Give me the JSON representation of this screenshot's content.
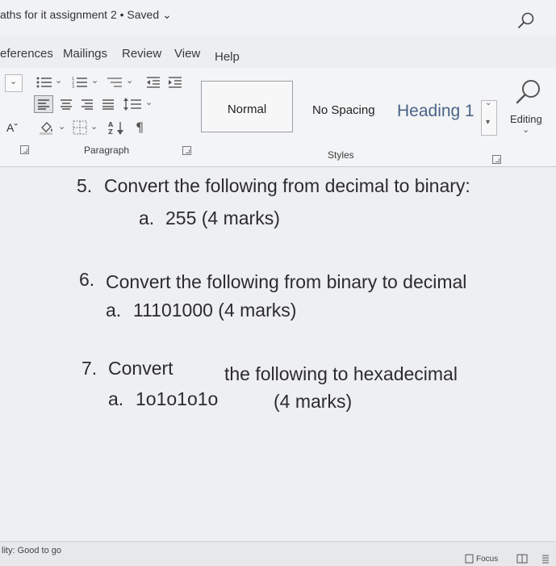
{
  "titlebar": {
    "doc_title": "aths for it assignment 2 • Saved ⌄"
  },
  "ribbon_tabs": [
    "eferences",
    "Mailings",
    "Review",
    "View",
    "Help"
  ],
  "ribbon": {
    "font_grow_label": "Aˇ",
    "paragraph_label": "Paragraph",
    "styles_label": "Styles",
    "styles": [
      "Normal",
      "No Spacing",
      "Heading 1"
    ],
    "editing_label": "Editing"
  },
  "document": {
    "q5_number": "5.",
    "q5_text": "Convert the following from decimal to binary:",
    "q5a_marker": "a.",
    "q5a_text": "255   (4 marks)",
    "q6_number": "6.",
    "q6_text": "Convert the following from binary to decimal",
    "q6a_marker": "a.",
    "q6a_text": "11101000 (4 marks)",
    "q7_number": "7.",
    "q7_word": "Convert",
    "q7_text": "the following to hexadecimal",
    "q7a_marker": "a.",
    "q7a_value": "1o1o1o1o",
    "q7a_marks": "(4 marks)"
  },
  "statusbar": {
    "accessibility": "lity: Good to go",
    "focus": "Focus"
  },
  "icons": [
    "search-icon",
    "bullets-icon",
    "numbering-icon",
    "multilevel-list-icon",
    "decrease-indent-icon",
    "increase-indent-icon",
    "align-left-icon",
    "align-center-icon",
    "align-right-icon",
    "justify-icon",
    "line-spacing-icon",
    "shading-icon",
    "borders-icon",
    "sort-icon",
    "pilcrow-icon",
    "dialog-launcher-icon",
    "editing-search-icon",
    "focus-icon",
    "read-mode-icon",
    "print-layout-icon"
  ]
}
